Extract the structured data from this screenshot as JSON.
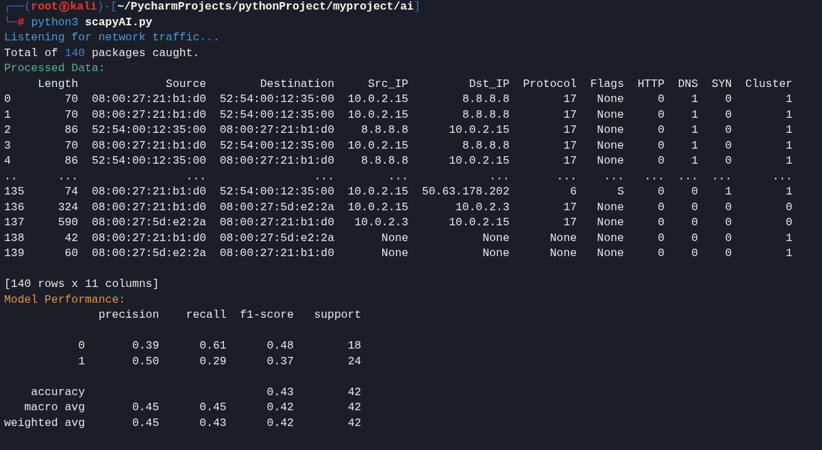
{
  "prompt": {
    "frame_top": "┌──(",
    "user": "root",
    "host": "kali",
    "frame_mid": ")-[",
    "path": "~/PycharmProjects/pythonProject/myproject/ai",
    "frame_end": "]",
    "frame_bottom": "└─",
    "symbol": "#",
    "command": "python3",
    "argument": "scapyAI.py"
  },
  "listening": "Listening for network traffic...",
  "total": {
    "prefix": "Total of",
    "count": "140",
    "suffix": "packages caught."
  },
  "processed_heading": "Processed Data:",
  "dataframe": {
    "columns": [
      "Length",
      "Source",
      "Destination",
      "Src_IP",
      "Dst_IP",
      "Protocol",
      "Flags",
      "HTTP",
      "DNS",
      "SYN",
      "Cluster"
    ],
    "rows": [
      {
        "index": "0",
        "cells": [
          "70",
          "08:00:27:21:b1:d0",
          "52:54:00:12:35:00",
          "10.0.2.15",
          "8.8.8.8",
          "17",
          "None",
          "0",
          "1",
          "0",
          "1"
        ]
      },
      {
        "index": "1",
        "cells": [
          "70",
          "08:00:27:21:b1:d0",
          "52:54:00:12:35:00",
          "10.0.2.15",
          "8.8.8.8",
          "17",
          "None",
          "0",
          "1",
          "0",
          "1"
        ]
      },
      {
        "index": "2",
        "cells": [
          "86",
          "52:54:00:12:35:00",
          "08:00:27:21:b1:d0",
          "8.8.8.8",
          "10.0.2.15",
          "17",
          "None",
          "0",
          "1",
          "0",
          "1"
        ]
      },
      {
        "index": "3",
        "cells": [
          "70",
          "08:00:27:21:b1:d0",
          "52:54:00:12:35:00",
          "10.0.2.15",
          "8.8.8.8",
          "17",
          "None",
          "0",
          "1",
          "0",
          "1"
        ]
      },
      {
        "index": "4",
        "cells": [
          "86",
          "52:54:00:12:35:00",
          "08:00:27:21:b1:d0",
          "8.8.8.8",
          "10.0.2.15",
          "17",
          "None",
          "0",
          "1",
          "0",
          "1"
        ]
      },
      {
        "index": "..",
        "cells": [
          "...",
          "...",
          "...",
          "...",
          "...",
          "...",
          "...",
          "...",
          "...",
          "...",
          "..."
        ]
      },
      {
        "index": "135",
        "cells": [
          "74",
          "08:00:27:21:b1:d0",
          "52:54:00:12:35:00",
          "10.0.2.15",
          "50.63.178.202",
          "6",
          "S",
          "0",
          "0",
          "1",
          "1"
        ]
      },
      {
        "index": "136",
        "cells": [
          "324",
          "08:00:27:21:b1:d0",
          "08:00:27:5d:e2:2a",
          "10.0.2.15",
          "10.0.2.3",
          "17",
          "None",
          "0",
          "0",
          "0",
          "0"
        ]
      },
      {
        "index": "137",
        "cells": [
          "590",
          "08:00:27:5d:e2:2a",
          "08:00:27:21:b1:d0",
          "10.0.2.3",
          "10.0.2.15",
          "17",
          "None",
          "0",
          "0",
          "0",
          "0"
        ]
      },
      {
        "index": "138",
        "cells": [
          "42",
          "08:00:27:21:b1:d0",
          "08:00:27:5d:e2:2a",
          "None",
          "None",
          "None",
          "None",
          "0",
          "0",
          "0",
          "1"
        ]
      },
      {
        "index": "139",
        "cells": [
          "60",
          "08:00:27:5d:e2:2a",
          "08:00:27:21:b1:d0",
          "None",
          "None",
          "None",
          "None",
          "0",
          "0",
          "0",
          "1"
        ]
      }
    ]
  },
  "dataframe_shape": "[140 rows x 11 columns]",
  "performance_heading": "Model Performance:",
  "report": {
    "columns": [
      "precision",
      "recall",
      "f1-score",
      "support"
    ],
    "classes": [
      {
        "label": "0",
        "cells": [
          "0.39",
          "0.61",
          "0.48",
          "18"
        ]
      },
      {
        "label": "1",
        "cells": [
          "0.50",
          "0.29",
          "0.37",
          "24"
        ]
      }
    ],
    "averages": [
      {
        "label": "accuracy",
        "cells": [
          null,
          null,
          "0.43",
          "42"
        ]
      },
      {
        "label": "macro avg",
        "cells": [
          "0.45",
          "0.45",
          "0.42",
          "42"
        ]
      },
      {
        "label": "weighted avg",
        "cells": [
          "0.45",
          "0.43",
          "0.42",
          "42"
        ]
      }
    ]
  }
}
